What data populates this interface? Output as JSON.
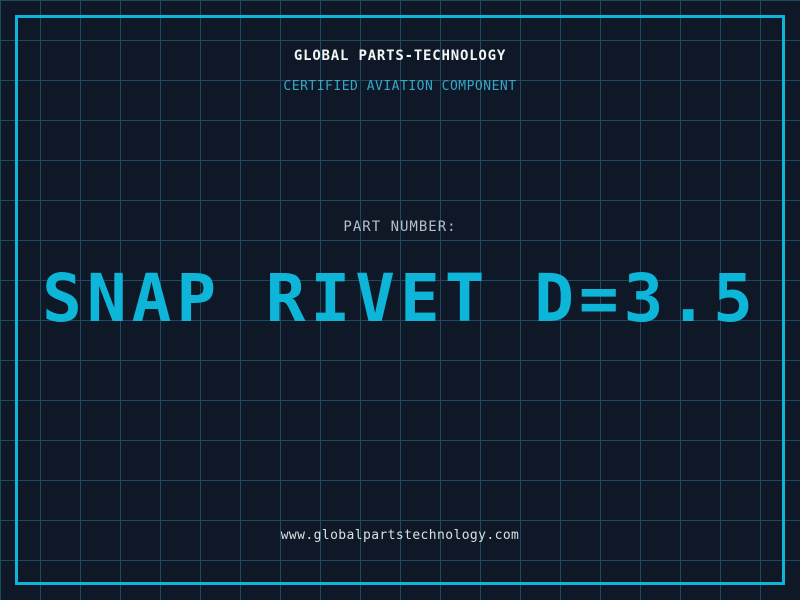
{
  "theme": {
    "background": "#0f1826",
    "grid_line": "#1c4a60",
    "frame_border": "#0db6d8",
    "title_color": "#f2f5f6",
    "subtitle_color": "#36a7c8",
    "label_color": "#b3c0ca",
    "part_number_color": "#0db6d8",
    "url_color": "#d9e0e4"
  },
  "header": {
    "company_name": "GLOBAL PARTS-TECHNOLOGY",
    "tagline": "CERTIFIED AVIATION COMPONENT"
  },
  "part": {
    "label": "PART NUMBER:",
    "number": "SNAP RIVET D=3.5"
  },
  "footer": {
    "website": "www.globalpartstechnology.com"
  }
}
